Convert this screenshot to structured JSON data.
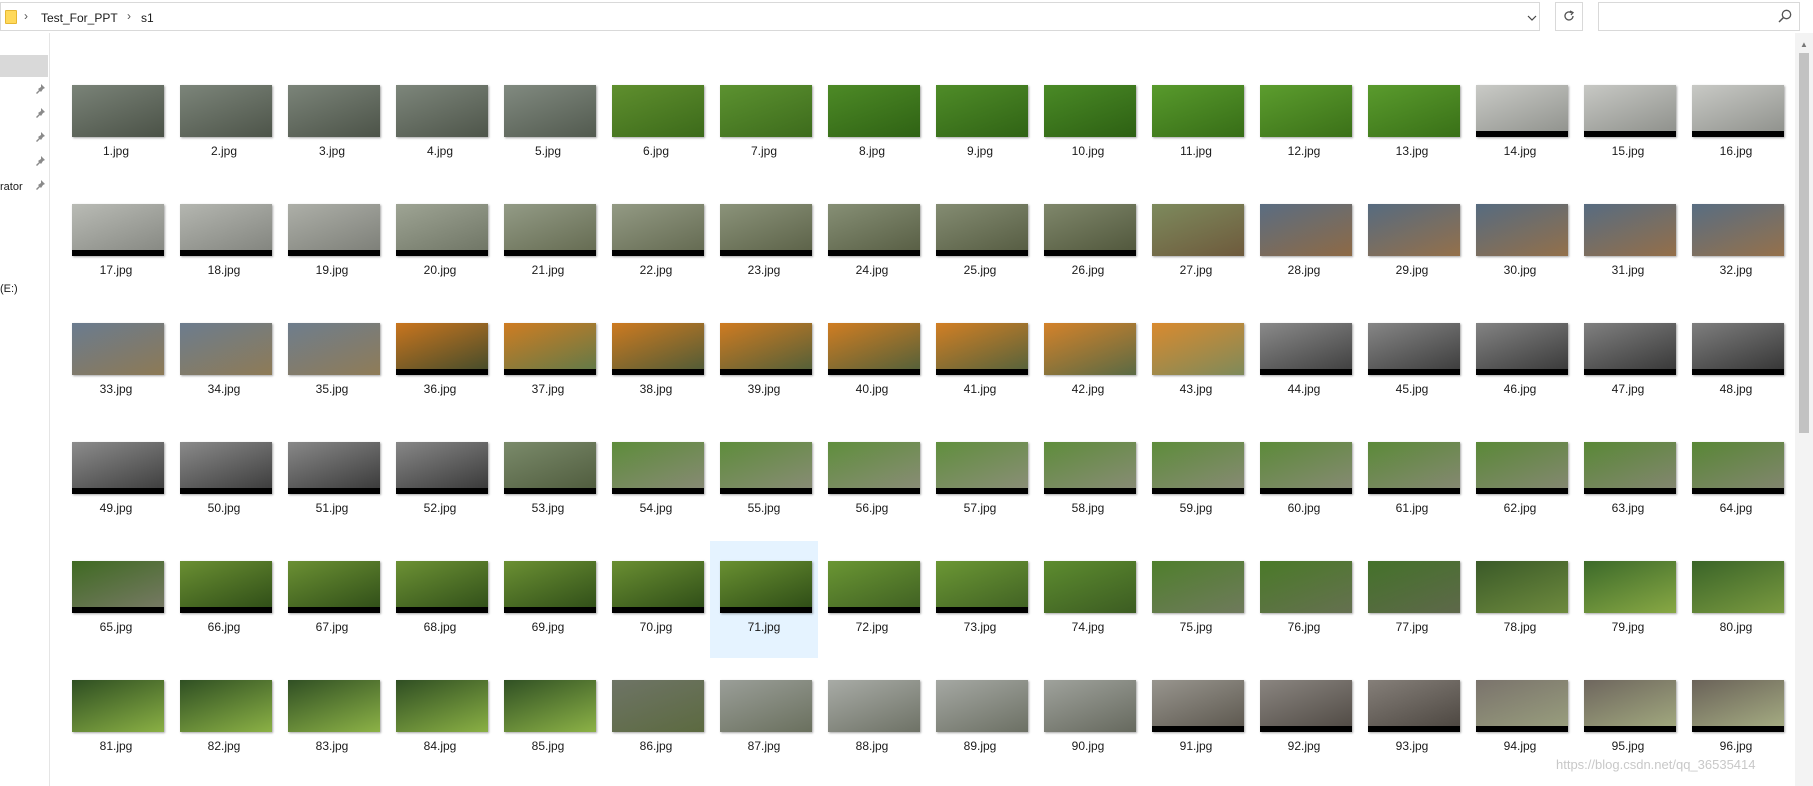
{
  "address": {
    "breadcrumbs": [
      "Test_For_PPT",
      "s1"
    ],
    "separator": "›",
    "dropdown_icon": "chevron-down-icon",
    "refresh_icon": "refresh-icon"
  },
  "search": {
    "placeholder": "",
    "icon": "search-icon"
  },
  "nav": {
    "items": [
      {
        "label": "",
        "pinned": true
      },
      {
        "label": "",
        "pinned": true
      },
      {
        "label": "",
        "pinned": true
      },
      {
        "label": "",
        "pinned": true
      },
      {
        "label": "rator",
        "pinned": true
      },
      {
        "label": "(E:)",
        "pinned": false
      }
    ]
  },
  "files": [
    {
      "name": "1.jpg",
      "colors": [
        "#7a8378",
        "#4b5247"
      ],
      "bar": false
    },
    {
      "name": "2.jpg",
      "colors": [
        "#7c857a",
        "#4d5449"
      ],
      "bar": false
    },
    {
      "name": "3.jpg",
      "colors": [
        "#7b8479",
        "#4c5348"
      ],
      "bar": false
    },
    {
      "name": "4.jpg",
      "colors": [
        "#7d867b",
        "#4e554a"
      ],
      "bar": false
    },
    {
      "name": "5.jpg",
      "colors": [
        "#818a80",
        "#525a4f"
      ],
      "bar": false
    },
    {
      "name": "6.jpg",
      "colors": [
        "#5f8f2e",
        "#3c6a1a"
      ],
      "bar": false
    },
    {
      "name": "7.jpg",
      "colors": [
        "#5c9230",
        "#3d6b1c"
      ],
      "bar": false
    },
    {
      "name": "8.jpg",
      "colors": [
        "#4d8a26",
        "#2f6214"
      ],
      "bar": false
    },
    {
      "name": "9.jpg",
      "colors": [
        "#4f8c28",
        "#306315"
      ],
      "bar": false
    },
    {
      "name": "10.jpg",
      "colors": [
        "#4a8a26",
        "#2d6013"
      ],
      "bar": false
    },
    {
      "name": "11.jpg",
      "colors": [
        "#589a2c",
        "#376d17"
      ],
      "bar": false
    },
    {
      "name": "12.jpg",
      "colors": [
        "#5c9d2e",
        "#3b7018"
      ],
      "bar": false
    },
    {
      "name": "13.jpg",
      "colors": [
        "#5a9b2d",
        "#397017"
      ],
      "bar": false
    },
    {
      "name": "14.jpg",
      "colors": [
        "#c9cac6",
        "#8e908b"
      ],
      "bar": true
    },
    {
      "name": "15.jpg",
      "colors": [
        "#c7c8c4",
        "#8c8e89"
      ],
      "bar": true
    },
    {
      "name": "16.jpg",
      "colors": [
        "#c8c9c5",
        "#8d8f8a"
      ],
      "bar": true
    },
    {
      "name": "17.jpg",
      "colors": [
        "#b9bbb5",
        "#848680"
      ],
      "bar": true
    },
    {
      "name": "18.jpg",
      "colors": [
        "#b4b6b0",
        "#80827c"
      ],
      "bar": true
    },
    {
      "name": "19.jpg",
      "colors": [
        "#adafa8",
        "#7b7d76"
      ],
      "bar": true
    },
    {
      "name": "20.jpg",
      "colors": [
        "#9ea494",
        "#6d7363"
      ],
      "bar": true
    },
    {
      "name": "21.jpg",
      "colors": [
        "#939b86",
        "#63694f"
      ],
      "bar": true
    },
    {
      "name": "22.jpg",
      "colors": [
        "#939a84",
        "#62684f"
      ],
      "bar": true
    },
    {
      "name": "23.jpg",
      "colors": [
        "#8b937a",
        "#5a6046"
      ],
      "bar": true
    },
    {
      "name": "24.jpg",
      "colors": [
        "#868f75",
        "#565c42"
      ],
      "bar": true
    },
    {
      "name": "25.jpg",
      "colors": [
        "#848c72",
        "#545a40"
      ],
      "bar": true
    },
    {
      "name": "26.jpg",
      "colors": [
        "#7f876b",
        "#4f553a"
      ],
      "bar": true
    },
    {
      "name": "27.jpg",
      "colors": [
        "#7d8a5d",
        "#6e5a3c"
      ],
      "bar": false
    },
    {
      "name": "28.jpg",
      "colors": [
        "#5a6d82",
        "#8e6a45"
      ],
      "bar": false
    },
    {
      "name": "29.jpg",
      "colors": [
        "#566b80",
        "#94704a"
      ],
      "bar": false
    },
    {
      "name": "30.jpg",
      "colors": [
        "#566b80",
        "#93704a"
      ],
      "bar": false
    },
    {
      "name": "31.jpg",
      "colors": [
        "#576c81",
        "#946f49"
      ],
      "bar": false
    },
    {
      "name": "32.jpg",
      "colors": [
        "#586d82",
        "#95714b"
      ],
      "bar": false
    },
    {
      "name": "33.jpg",
      "colors": [
        "#6a7b8f",
        "#8d7a55"
      ],
      "bar": false
    },
    {
      "name": "34.jpg",
      "colors": [
        "#6c7c8e",
        "#8e7b56"
      ],
      "bar": false
    },
    {
      "name": "35.jpg",
      "colors": [
        "#6e7d8d",
        "#8f7c57"
      ],
      "bar": false
    },
    {
      "name": "36.jpg",
      "colors": [
        "#c9751e",
        "#3e4a2c"
      ],
      "bar": true
    },
    {
      "name": "37.jpg",
      "colors": [
        "#cf7c22",
        "#5c7a4a"
      ],
      "bar": true
    },
    {
      "name": "38.jpg",
      "colors": [
        "#cd7a20",
        "#4a5a38"
      ],
      "bar": true
    },
    {
      "name": "39.jpg",
      "colors": [
        "#cf7b21",
        "#4c5e3a"
      ],
      "bar": true
    },
    {
      "name": "40.jpg",
      "colors": [
        "#d07d22",
        "#4d5f3b"
      ],
      "bar": true
    },
    {
      "name": "41.jpg",
      "colors": [
        "#d27f24",
        "#4f613d"
      ],
      "bar": true
    },
    {
      "name": "42.jpg",
      "colors": [
        "#d4822a",
        "#5a6a44"
      ],
      "bar": false
    },
    {
      "name": "43.jpg",
      "colors": [
        "#d98a2f",
        "#7e8a5a"
      ],
      "bar": false
    },
    {
      "name": "44.jpg",
      "colors": [
        "#8a8a8a",
        "#3c3c3c"
      ],
      "bar": true
    },
    {
      "name": "45.jpg",
      "colors": [
        "#868686",
        "#393939"
      ],
      "bar": true
    },
    {
      "name": "46.jpg",
      "colors": [
        "#838383",
        "#363636"
      ],
      "bar": true
    },
    {
      "name": "47.jpg",
      "colors": [
        "#808080",
        "#343434"
      ],
      "bar": true
    },
    {
      "name": "48.jpg",
      "colors": [
        "#7e7e7e",
        "#323232"
      ],
      "bar": true
    },
    {
      "name": "49.jpg",
      "colors": [
        "#8c8c8c",
        "#3a3a3a"
      ],
      "bar": true
    },
    {
      "name": "50.jpg",
      "colors": [
        "#8a8a8a",
        "#383838"
      ],
      "bar": true
    },
    {
      "name": "51.jpg",
      "colors": [
        "#888888",
        "#363636"
      ],
      "bar": true
    },
    {
      "name": "52.jpg",
      "colors": [
        "#878787",
        "#353535"
      ],
      "bar": true
    },
    {
      "name": "53.jpg",
      "colors": [
        "#7a8a6a",
        "#4e5a3c"
      ],
      "bar": true
    },
    {
      "name": "54.jpg",
      "colors": [
        "#5d8c3a",
        "#8a8a78"
      ],
      "bar": true
    },
    {
      "name": "55.jpg",
      "colors": [
        "#5e8d3b",
        "#8b8b79"
      ],
      "bar": true
    },
    {
      "name": "56.jpg",
      "colors": [
        "#5f8e3c",
        "#8c8c7a"
      ],
      "bar": true
    },
    {
      "name": "57.jpg",
      "colors": [
        "#608f3d",
        "#8d8d7b"
      ],
      "bar": true
    },
    {
      "name": "58.jpg",
      "colors": [
        "#5e8d3b",
        "#8b8b79"
      ],
      "bar": true
    },
    {
      "name": "59.jpg",
      "colors": [
        "#5d8c3a",
        "#8a8a78"
      ],
      "bar": true
    },
    {
      "name": "60.jpg",
      "colors": [
        "#5c8b39",
        "#898977"
      ],
      "bar": true
    },
    {
      "name": "61.jpg",
      "colors": [
        "#5b8a38",
        "#888876"
      ],
      "bar": true
    },
    {
      "name": "62.jpg",
      "colors": [
        "#5a8937",
        "#878775"
      ],
      "bar": true
    },
    {
      "name": "63.jpg",
      "colors": [
        "#598836",
        "#868674"
      ],
      "bar": true
    },
    {
      "name": "64.jpg",
      "colors": [
        "#588735",
        "#858573"
      ],
      "bar": true
    },
    {
      "name": "65.jpg",
      "colors": [
        "#3f6a22",
        "#7a7a68"
      ],
      "bar": true
    },
    {
      "name": "66.jpg",
      "colors": [
        "#6a8f32",
        "#2c4a16"
      ],
      "bar": true
    },
    {
      "name": "67.jpg",
      "colors": [
        "#6b9033",
        "#2d4b17"
      ],
      "bar": true
    },
    {
      "name": "68.jpg",
      "colors": [
        "#6c9134",
        "#2e4c18"
      ],
      "bar": true
    },
    {
      "name": "69.jpg",
      "colors": [
        "#6b9033",
        "#2d4b17"
      ],
      "bar": true
    },
    {
      "name": "70.jpg",
      "colors": [
        "#6a8f32",
        "#2c4a16"
      ],
      "bar": true
    },
    {
      "name": "71.jpg",
      "colors": [
        "#699031",
        "#2b4915"
      ],
      "bar": true
    },
    {
      "name": "72.jpg",
      "colors": [
        "#6a9633",
        "#3e5e22"
      ],
      "bar": true
    },
    {
      "name": "73.jpg",
      "colors": [
        "#6b9734",
        "#3f5f23"
      ],
      "bar": true
    },
    {
      "name": "74.jpg",
      "colors": [
        "#5d8c2f",
        "#3c5c22"
      ],
      "bar": false
    },
    {
      "name": "75.jpg",
      "colors": [
        "#4f7f2c",
        "#6f7a5c"
      ],
      "bar": false
    },
    {
      "name": "76.jpg",
      "colors": [
        "#4a7a28",
        "#657050"
      ],
      "bar": false
    },
    {
      "name": "77.jpg",
      "colors": [
        "#44722a",
        "#5e684a"
      ],
      "bar": false
    },
    {
      "name": "78.jpg",
      "colors": [
        "#3a5a28",
        "#6e8a3e"
      ],
      "bar": false
    },
    {
      "name": "79.jpg",
      "colors": [
        "#3c6a2a",
        "#88a844"
      ],
      "bar": false
    },
    {
      "name": "80.jpg",
      "colors": [
        "#3a6428",
        "#7a9a40"
      ],
      "bar": false
    },
    {
      "name": "81.jpg",
      "colors": [
        "#2e4e22",
        "#8ab044"
      ],
      "bar": false
    },
    {
      "name": "82.jpg",
      "colors": [
        "#2f4f23",
        "#8bb145"
      ],
      "bar": false
    },
    {
      "name": "83.jpg",
      "colors": [
        "#304f24",
        "#8cb246"
      ],
      "bar": false
    },
    {
      "name": "84.jpg",
      "colors": [
        "#2f4e23",
        "#8ab044"
      ],
      "bar": false
    },
    {
      "name": "85.jpg",
      "colors": [
        "#305024",
        "#8cb246"
      ],
      "bar": false
    },
    {
      "name": "86.jpg",
      "colors": [
        "#6e7466",
        "#5c6a40"
      ],
      "bar": false
    },
    {
      "name": "87.jpg",
      "colors": [
        "#9a9e98",
        "#6a705e"
      ],
      "bar": false
    },
    {
      "name": "88.jpg",
      "colors": [
        "#a8aba6",
        "#6e7266"
      ],
      "bar": false
    },
    {
      "name": "89.jpg",
      "colors": [
        "#a5a8a3",
        "#6c7064"
      ],
      "bar": false
    },
    {
      "name": "90.jpg",
      "colors": [
        "#9fa29c",
        "#66695e"
      ],
      "bar": false
    },
    {
      "name": "91.jpg",
      "colors": [
        "#98958e",
        "#5a554c"
      ],
      "bar": true
    },
    {
      "name": "92.jpg",
      "colors": [
        "#8a8580",
        "#4e4842"
      ],
      "bar": true
    },
    {
      "name": "93.jpg",
      "colors": [
        "#857f79",
        "#4a443e"
      ],
      "bar": true
    },
    {
      "name": "94.jpg",
      "colors": [
        "#7a736c",
        "#9aa07e"
      ],
      "bar": true
    },
    {
      "name": "95.jpg",
      "colors": [
        "#6e665e",
        "#a4ac80"
      ],
      "bar": true
    },
    {
      "name": "96.jpg",
      "colors": [
        "#6a6259",
        "#a8b084"
      ],
      "bar": true
    }
  ],
  "selected_file": "71.jpg",
  "colors": {
    "selection": "#e5f3ff",
    "nav_selected": "#d9d9d9",
    "folder": "#ffd95a",
    "scroll_thumb": "#c2c2c2"
  },
  "watermark": "https://blog.csdn.net/qq_36535414"
}
